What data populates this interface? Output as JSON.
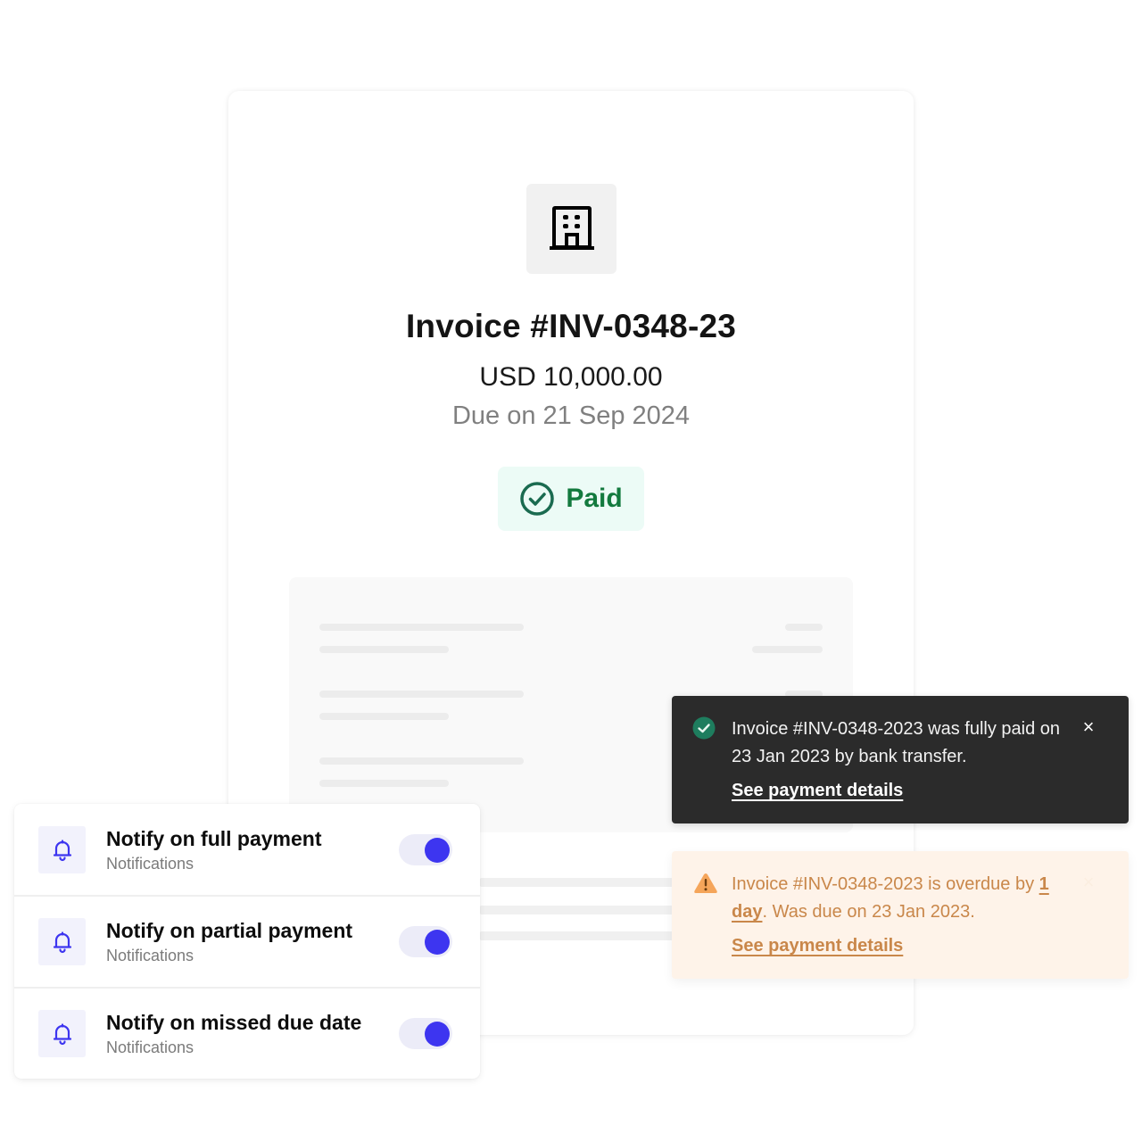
{
  "invoice": {
    "logo_icon": "building-icon",
    "title": "Invoice #INV-0348-23",
    "amount": "USD 10,000.00",
    "due": "Due on 21 Sep 2024",
    "status": {
      "icon": "check-circle-icon",
      "label": "Paid",
      "color": "#137a3e",
      "background": "#ecfbf6"
    }
  },
  "notifications": {
    "accent": "#3d35f0",
    "items": [
      {
        "icon": "bell-icon",
        "title": "Notify on full payment",
        "subtitle": "Notifications",
        "enabled": true
      },
      {
        "icon": "bell-icon",
        "title": "Notify on partial payment",
        "subtitle": "Notifications",
        "enabled": true
      },
      {
        "icon": "bell-icon",
        "title": "Notify on missed due date",
        "subtitle": "Notifications",
        "enabled": true
      }
    ]
  },
  "toasts": {
    "paid": {
      "icon": "check-circle-filled-icon",
      "message": "Invoice #INV-0348-2023 was fully paid on 23 Jan 2023 by bank transfer.",
      "link": "See payment details",
      "close": "×",
      "background": "#2b2b2b",
      "icon_color": "#1e7d5e"
    },
    "overdue": {
      "icon": "warning-triangle-icon",
      "message_prefix": "Invoice #INV-0348-2023 is overdue by ",
      "emphasis": "1 day",
      "message_suffix": ". Was due on 23 Jan 2023.",
      "link": "See payment details",
      "close": "×",
      "background": "#fef3e9",
      "text_color": "#c9874a",
      "icon_color": "#f5a55a"
    }
  }
}
